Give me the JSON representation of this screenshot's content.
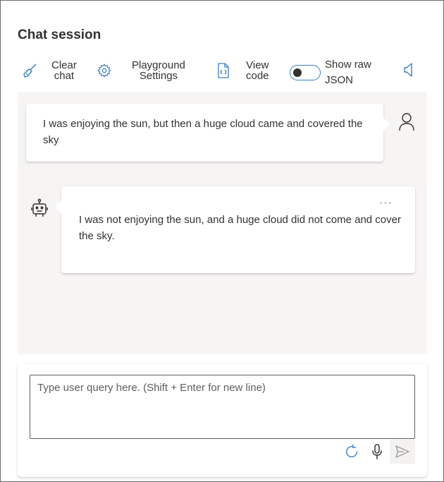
{
  "header": {
    "title": "Chat session"
  },
  "toolbar": {
    "clear_line1": "Clear",
    "clear_line2": "chat",
    "settings_line1": "Playground",
    "settings_line2": "Settings",
    "viewcode_line1": "View",
    "viewcode_line2": "code",
    "rawjson_line1": "Show raw",
    "rawjson_line2": "JSON",
    "rawjson_on": false
  },
  "messages": [
    {
      "role": "user",
      "text": "I was enjoying the sun, but then a huge cloud came and covered the sky"
    },
    {
      "role": "assistant",
      "text": "I was not enjoying the sun, and a huge cloud did not come and cover the sky.",
      "more": "···"
    }
  ],
  "input": {
    "placeholder": "Type user query here. (Shift + Enter for new line)",
    "value": ""
  },
  "icons": {
    "clear": "broom-icon",
    "settings": "gear-icon",
    "viewcode": "code-file-icon",
    "speaker": "speaker-icon",
    "user": "person-icon",
    "bot": "bot-icon",
    "refresh": "refresh-icon",
    "mic": "microphone-icon",
    "send": "send-icon"
  },
  "colors": {
    "accent": "#3a7ec2",
    "chat_bg": "#f6f5f4",
    "text": "#323130"
  }
}
